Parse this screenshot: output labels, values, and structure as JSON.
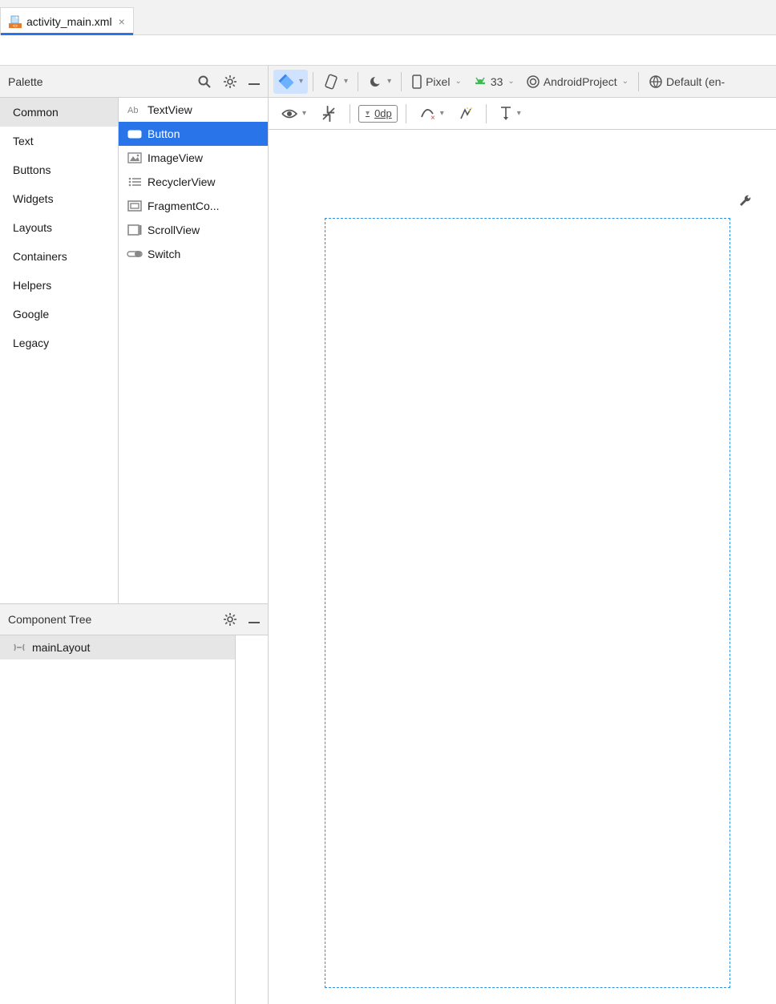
{
  "tab": {
    "filename": "activity_main.xml"
  },
  "palette": {
    "title": "Palette",
    "categories": [
      "Common",
      "Text",
      "Buttons",
      "Widgets",
      "Layouts",
      "Containers",
      "Helpers",
      "Google",
      "Legacy"
    ],
    "selectedCategory": 0,
    "items": [
      {
        "label": "TextView",
        "icon": "text"
      },
      {
        "label": "Button",
        "icon": "button"
      },
      {
        "label": "ImageView",
        "icon": "image"
      },
      {
        "label": "RecyclerView",
        "icon": "list"
      },
      {
        "label": "FragmentCo...",
        "icon": "frame"
      },
      {
        "label": "ScrollView",
        "icon": "scroll"
      },
      {
        "label": "Switch",
        "icon": "switch"
      }
    ],
    "selectedItem": 1
  },
  "componentTree": {
    "title": "Component Tree",
    "root": "mainLayout"
  },
  "toolbar": {
    "device": "Pixel",
    "api": "33",
    "project": "AndroidProject",
    "locale": "Default (en-",
    "defaultMargin": "0dp"
  }
}
